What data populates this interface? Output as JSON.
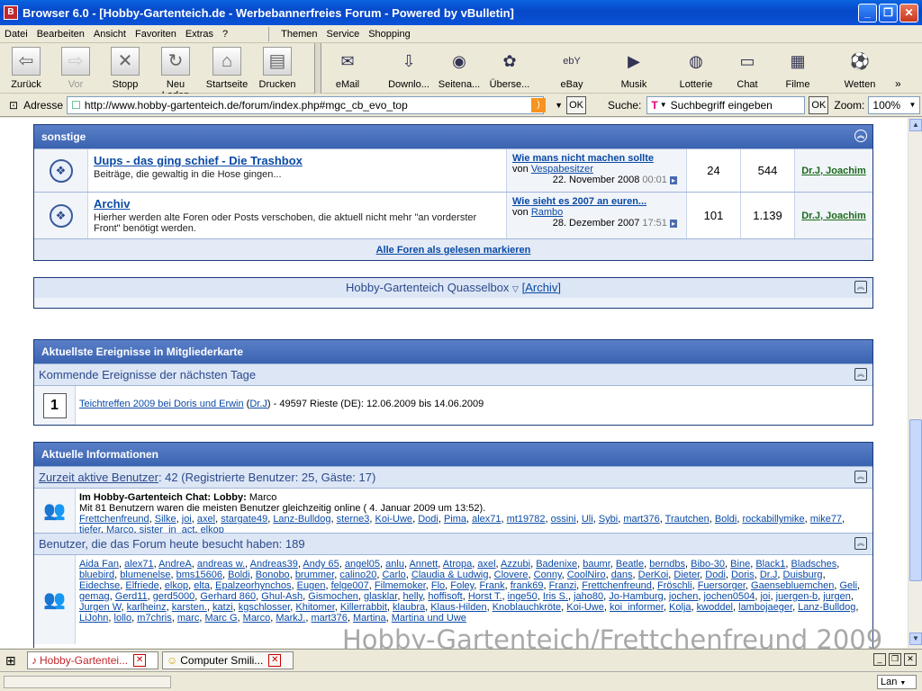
{
  "window": {
    "title": "Browser 6.0 - [Hobby-Gartenteich.de - Werbebannerfreies Forum - Powered by vBulletin]"
  },
  "menu": {
    "left": [
      "Datei",
      "Bearbeiten",
      "Ansicht",
      "Favoriten",
      "Extras",
      "?"
    ],
    "right": [
      "Themen",
      "Service",
      "Shopping"
    ]
  },
  "toolbar": {
    "nav": [
      {
        "label": "Zurück",
        "icon": "back-arrow-icon"
      },
      {
        "label": "Vor",
        "icon": "forward-arrow-icon"
      },
      {
        "label": "Stopp",
        "icon": "stop-icon"
      },
      {
        "label": "Neu Laden",
        "icon": "reload-icon"
      },
      {
        "label": "Startseite",
        "icon": "home-icon"
      },
      {
        "label": "Drucken",
        "icon": "printer-icon"
      }
    ],
    "services": [
      {
        "label": "eMail",
        "icon": "mail-icon"
      },
      {
        "label": "Downlo...",
        "icon": "download-icon"
      },
      {
        "label": "Seitena...",
        "icon": "globe-icon"
      },
      {
        "label": "Überse...",
        "icon": "dragon-icon"
      },
      {
        "label": "eBay",
        "icon": "ebay-icon"
      },
      {
        "label": "Musik",
        "icon": "play-icon"
      },
      {
        "label": "Lotterie",
        "icon": "lottery-icon"
      },
      {
        "label": "Chat",
        "icon": "chat-icon"
      },
      {
        "label": "Filme",
        "icon": "film-icon"
      },
      {
        "label": "Wetten",
        "icon": "soccer-ball-icon"
      }
    ]
  },
  "addressbar": {
    "label": "Adresse",
    "url": "http://www.hobby-gartenteich.de/forum/index.php#mgc_cb_evo_top",
    "ok": "OK",
    "search_label": "Suche:",
    "search_placeholder": "Suchbegriff eingeben",
    "zoom_label": "Zoom:",
    "zoom_value": "100%"
  },
  "sonstige": {
    "title": "sonstige",
    "forums": [
      {
        "title": "Uups - das ging schief - Die Trashbox",
        "desc": "Beiträge, die gewaltig in die Hose gingen...",
        "last_title": "Wie mans nicht machen sollte",
        "last_by_prefix": "von",
        "last_by": "Vespabesitzer",
        "last_date": "22. November 2008",
        "last_time": "00:01",
        "threads": "24",
        "posts": "544",
        "mods": "Dr.J, Joachim"
      },
      {
        "title": "Archiv",
        "desc": "Hierher werden alte Foren oder Posts verschoben, die aktuell nicht mehr \"an vorderster Front\" benötigt werden.",
        "last_title": "Wie sieht es 2007 an euren...",
        "last_by_prefix": "von",
        "last_by": "Rambo",
        "last_date": "28. Dezember 2007",
        "last_time": "17:51",
        "threads": "101",
        "posts": "1.139",
        "mods": "Dr.J, Joachim"
      }
    ],
    "mark_all": "Alle Foren als gelesen markieren"
  },
  "quasselbox": {
    "title": "Hobby-Gartenteich Quasselbox",
    "archive": "[Archiv]"
  },
  "events": {
    "title": "Aktuellste Ereignisse in Mitgliederkarte",
    "subtitle": "Kommende Ereignisse der nächsten Tage",
    "event_link": "Teichtreffen 2009 bei Doris und Erwin",
    "event_user": "Dr.J",
    "event_rest": "- 49597 Rieste (DE): 12.06.2009 bis 14.06.2009"
  },
  "info": {
    "title": "Aktuelle Informationen",
    "active_link": "Zurzeit aktive Benutzer",
    "active_rest": ": 42 (Registrierte Benutzer: 25, Gäste: 17)",
    "chat_label": "Im Hobby-Gartenteich Chat: Lobby:",
    "chat_user": "Marco",
    "record": "Mit 81 Benutzern waren die meisten Benutzer gleichzeitig online ( 4. Januar 2009 um 13:52).",
    "active_users": [
      "Frettchenfreund",
      "Silke",
      "joi",
      "axel",
      "stargate49",
      "Lanz-Bulldog",
      "sterne3",
      "Koi-Uwe",
      "Dodi",
      "Pima",
      "alex71",
      "mt19782",
      "ossini",
      "Uli",
      "Sybi",
      "mart376",
      "Trautchen",
      "Boldi",
      "rockabillymike",
      "mike77",
      "tiefer",
      "Marco",
      "sister_in_act",
      "elkop"
    ],
    "today_title": "Benutzer, die das Forum heute besucht haben: 189",
    "today_users": [
      "Aida Fan",
      "alex71",
      "AndreA",
      "andreas w.",
      "Andreas39",
      "Andy 65",
      "angel05",
      "anlu",
      "Annett",
      "Atropa",
      "axel",
      "Azzubi",
      "Badenixe",
      "baumr",
      "Beatle",
      "berndbs",
      "Bibo-30",
      "Bine",
      "Black1",
      "Bladsches",
      "bluebird",
      "blumenelse",
      "bms15606",
      "Boldi",
      "Bonobo",
      "brummer",
      "calino20",
      "Carlo",
      "Claudia & Ludwig",
      "Clovere",
      "Conny",
      "CoolNiro",
      "dans",
      "DerKoi",
      "Dieter",
      "Dodi",
      "Doris",
      "Dr.J",
      "Duisburg",
      "Eidechse",
      "Elfriede",
      "elkop",
      "elta",
      "Epalzeorhynchos",
      "Eugen",
      "felge007",
      "Filmemoker",
      "Flo",
      "Foley",
      "Frank",
      "frank69",
      "Franzi",
      "Frettchenfreund",
      "Fröschli",
      "Fuersorger",
      "Gaensebluemchen",
      "Geli",
      "gemag",
      "Gerd11",
      "gerd5000",
      "Gerhard 860",
      "Ghul-Ash",
      "Gismochen",
      "glasklar",
      "helly",
      "hoffisoft",
      "Horst T.",
      "inge50",
      "Iris S.",
      "jaho80",
      "Jo-Hamburg",
      "jochen",
      "jochen0504",
      "joi",
      "juergen-b",
      "jurgen",
      "Jurgen W",
      "karlheinz",
      "karsten.",
      "katzi",
      "kgschlosser",
      "Khitomer",
      "Killerrabbit",
      "klaubra",
      "Klaus-Hilden",
      "Knoblauchkröte",
      "Koi-Uwe",
      "koi_informer",
      "Kolja",
      "kwoddel",
      "lambojaeger",
      "Lanz-Bulldog",
      "LiJohn",
      "lollo",
      "m7chris",
      "marc",
      "Marc G",
      "Marco",
      "MarkJ.",
      "mart376",
      "Martina",
      "Martina und Uwe"
    ]
  },
  "watermark": "Hobby-Gartenteich/Frettchenfreund 2009",
  "tabs": [
    {
      "label": "Hobby-Gartentei...",
      "close": "✕"
    },
    {
      "label": "Computer Smili...",
      "close": "✕"
    }
  ],
  "statusbar": {
    "conn": "Lan"
  }
}
